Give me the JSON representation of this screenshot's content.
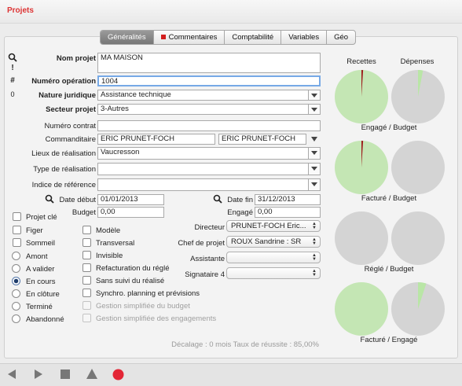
{
  "window": {
    "title": "Projets"
  },
  "tabs": [
    {
      "label": "Généralités",
      "active": true
    },
    {
      "label": "Commentaires",
      "marker": "red-square"
    },
    {
      "label": "Comptabilité"
    },
    {
      "label": "Variables"
    },
    {
      "label": "Géo"
    }
  ],
  "side_toolbar": {
    "search": "search-icon",
    "exclamation": "!",
    "hash": "#",
    "count": "0"
  },
  "form": {
    "nom_projet": {
      "label": "Nom projet",
      "value": "MA MAISON"
    },
    "numero_operation": {
      "label": "Numéro opération",
      "value": "1004"
    },
    "nature_juridique": {
      "label": "Nature juridique",
      "value": "Assistance technique"
    },
    "secteur_projet": {
      "label": "Secteur projet",
      "value": "3-Autres"
    },
    "numero_contrat": {
      "label": "Numéro contrat",
      "value": ""
    },
    "commanditaire": {
      "label": "Commanditaire",
      "value1": "ERIC PRUNET-FOCH",
      "value2": "ERIC PRUNET-FOCH"
    },
    "lieux_realisation": {
      "label": "Lieux de réalisation",
      "value": "Vaucresson"
    },
    "type_realisation": {
      "label": "Type de réalisation",
      "value": ""
    },
    "indice_reference": {
      "label": "Indice de référence",
      "value": ""
    },
    "date_debut": {
      "label": "Date début",
      "value": "01/01/2013"
    },
    "date_fin": {
      "label": "Date fin",
      "value": "31/12/2013"
    },
    "budget": {
      "label": "Budget",
      "value": "0,00"
    },
    "engage": {
      "label": "Engagé",
      "value": "0,00"
    }
  },
  "status_col1": [
    {
      "label": "Projet clé",
      "type": "checkbox",
      "checked": false
    },
    {
      "label": "Figer",
      "type": "checkbox",
      "checked": false
    },
    {
      "label": "Sommeil",
      "type": "checkbox",
      "checked": false
    },
    {
      "label": "Amont",
      "type": "radio",
      "checked": false
    },
    {
      "label": "A valider",
      "type": "radio",
      "checked": false
    },
    {
      "label": "En cours",
      "type": "radio",
      "checked": true
    },
    {
      "label": "En clôture",
      "type": "radio",
      "checked": false
    },
    {
      "label": "Terminé",
      "type": "radio",
      "checked": false
    },
    {
      "label": "Abandonné",
      "type": "radio",
      "checked": false
    }
  ],
  "options_col2": [
    {
      "label": "Modèle",
      "disabled": false
    },
    {
      "label": "Transversal",
      "disabled": false
    },
    {
      "label": "Invisible",
      "disabled": false
    },
    {
      "label": "Refacturation du réglé",
      "disabled": false
    },
    {
      "label": "Sans suivi du réalisé",
      "disabled": false
    },
    {
      "label": "Synchro. planning et prévisions",
      "disabled": false
    },
    {
      "label": "Gestion simplifiée du budget",
      "disabled": true
    },
    {
      "label": "Gestion simplifiée des engagements",
      "disabled": true
    }
  ],
  "assignees": {
    "directeur": {
      "label": "Directeur",
      "value": "PRUNET-FOCH Eric..."
    },
    "chef_projet": {
      "label": "Chef de projet",
      "value": "ROUX Sandrine : SR"
    },
    "assistante": {
      "label": "Assistante",
      "value": ""
    },
    "signataire": {
      "label": "Signataire 4",
      "value": ""
    }
  },
  "footer_text": "Décalage : 0 mois Taux de réussite : 85,00%",
  "pies": {
    "column_labels": [
      "Recettes",
      "Dépenses"
    ],
    "colors": {
      "green": "#c4e6b4",
      "grey": "#d4d4d4",
      "red": "#9e1d1d",
      "light_green": "#b9e6a6"
    },
    "rows": [
      {
        "caption": "Engagé / Budget",
        "left": {
          "base": "green",
          "slice_color": "red",
          "slice_fraction": 0.01
        },
        "right": {
          "base": "grey",
          "slice_color": "light_green",
          "slice_fraction": 0.03
        }
      },
      {
        "caption": "Facturé / Budget",
        "left": {
          "base": "green",
          "slice_color": "red",
          "slice_fraction": 0.01
        },
        "right": {
          "base": "grey",
          "slice_color": "grey",
          "slice_fraction": 0
        }
      },
      {
        "caption": "Réglé / Budget",
        "left": {
          "base": "grey",
          "slice_color": "grey",
          "slice_fraction": 0
        },
        "right": {
          "base": "grey",
          "slice_color": "grey",
          "slice_fraction": 0
        }
      },
      {
        "caption": "Facturé / Engagé",
        "left": {
          "base": "green",
          "slice_color": "green",
          "slice_fraction": 0
        },
        "right": {
          "base": "grey",
          "slice_color": "light_green",
          "slice_fraction": 0.05
        }
      }
    ]
  },
  "bottom_toolbar": [
    "back-arrow-icon",
    "forward-arrow-icon",
    "stop-square-icon",
    "triangle-icon",
    "record-dot-icon"
  ]
}
